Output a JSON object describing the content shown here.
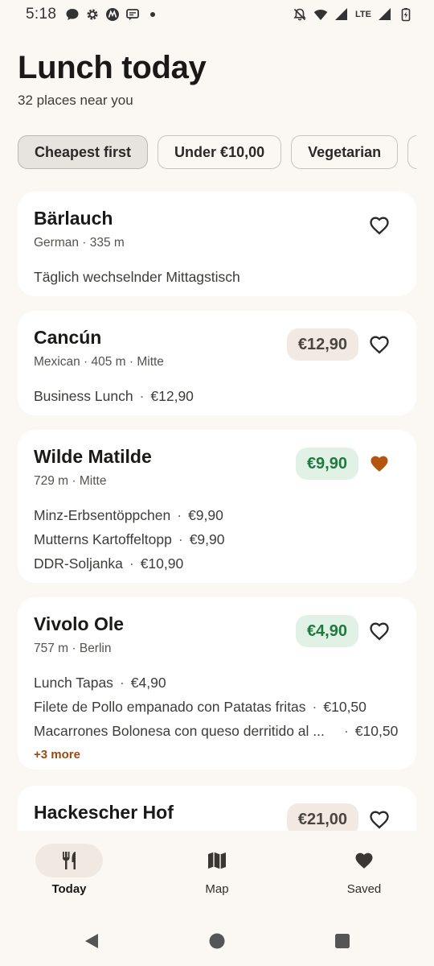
{
  "status_bar": {
    "time": "5:18",
    "left_icons": [
      "chat-bubble-icon",
      "chat-bubble-icon",
      "gear-icon",
      "motorola-icon",
      "message-icon",
      "dot-icon"
    ],
    "right_icons": [
      "bell-off-icon",
      "wifi-icon",
      "signal-icon",
      "lte-icon",
      "signal-icon",
      "battery-charging-icon"
    ],
    "lte_label": "LTE"
  },
  "header": {
    "title": "Lunch today",
    "subtitle": "32 places near you"
  },
  "filters": [
    {
      "label": "Cheapest first",
      "selected": true
    },
    {
      "label": "Under €10,00",
      "selected": false
    },
    {
      "label": "Vegetarian",
      "selected": false
    },
    {
      "label": "V",
      "selected": false
    }
  ],
  "restaurants": [
    {
      "name": "Bärlauch",
      "meta": "German · 335 m",
      "price": "",
      "favorite": false,
      "items": [
        {
          "name": "Täglich wechselnder Mittagstisch",
          "price": ""
        }
      ],
      "more": ""
    },
    {
      "name": "Cancún",
      "meta": "Mexican · 405 m · Mitte",
      "price": "€12,90",
      "price_tone": "neutral",
      "favorite": false,
      "items": [
        {
          "name": "Business Lunch",
          "price": "€12,90"
        }
      ],
      "more": ""
    },
    {
      "name": "Wilde Matilde",
      "meta": "729 m · Mitte",
      "price": "€9,90",
      "price_tone": "good",
      "favorite": true,
      "items": [
        {
          "name": "Minz-Erbsentöppchen",
          "price": "€9,90"
        },
        {
          "name": "Mutterns Kartoffeltopp",
          "price": "€9,90"
        },
        {
          "name": "DDR-Soljanka",
          "price": "€10,90"
        }
      ],
      "more": ""
    },
    {
      "name": "Vivolo Ole",
      "meta": "757 m · Berlin",
      "price": "€4,90",
      "price_tone": "good",
      "favorite": false,
      "items": [
        {
          "name": "Lunch Tapas",
          "price": "€4,90"
        },
        {
          "name": "Filete de Pollo empanado con Patatas fritas",
          "price": "€10,50"
        },
        {
          "name": "Macarrones Bolonesa con queso derritido al ...",
          "price": "€10,50"
        }
      ],
      "more": "+3 more"
    },
    {
      "name": "Hackescher Hof",
      "meta": "",
      "price": "€21,00",
      "price_tone": "neutral",
      "favorite": false,
      "items": [],
      "more": ""
    }
  ],
  "bottom_nav": [
    {
      "label": "Today",
      "icon": "fork-knife-icon",
      "active": true
    },
    {
      "label": "Map",
      "icon": "map-icon",
      "active": false
    },
    {
      "label": "Saved",
      "icon": "heart-icon",
      "active": false
    }
  ],
  "system_nav": [
    "back-icon",
    "home-icon",
    "recents-icon"
  ],
  "colors": {
    "background": "#FBF8F4",
    "card": "#FFFFFF",
    "accent_favorite": "#B5560E",
    "price_good_bg": "#E2F1E6",
    "price_good_text": "#1E7B3E",
    "price_neutral_bg": "#F1E9E2",
    "more_link": "#9A4A10"
  }
}
